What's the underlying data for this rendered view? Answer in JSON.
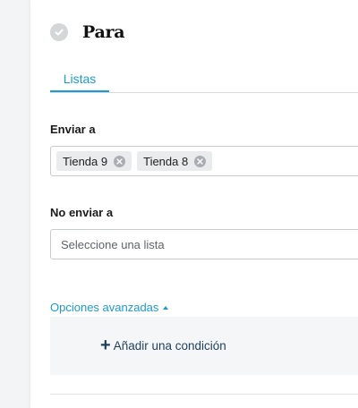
{
  "header": {
    "title": "Para",
    "status_icon": "check-circle-icon"
  },
  "tabs": [
    {
      "label": "Listas",
      "active": true
    }
  ],
  "send_to": {
    "label": "Enviar a",
    "chips": [
      {
        "label": "Tienda 9"
      },
      {
        "label": "Tienda 8"
      }
    ]
  },
  "dont_send_to": {
    "label": "No enviar a",
    "placeholder": "Seleccione una lista"
  },
  "advanced": {
    "label": "Opciones avanzadas",
    "add_condition_label": "Añadir una condición"
  },
  "colors": {
    "accent": "#1a9ad8",
    "dark_link": "#1f3f5c"
  }
}
